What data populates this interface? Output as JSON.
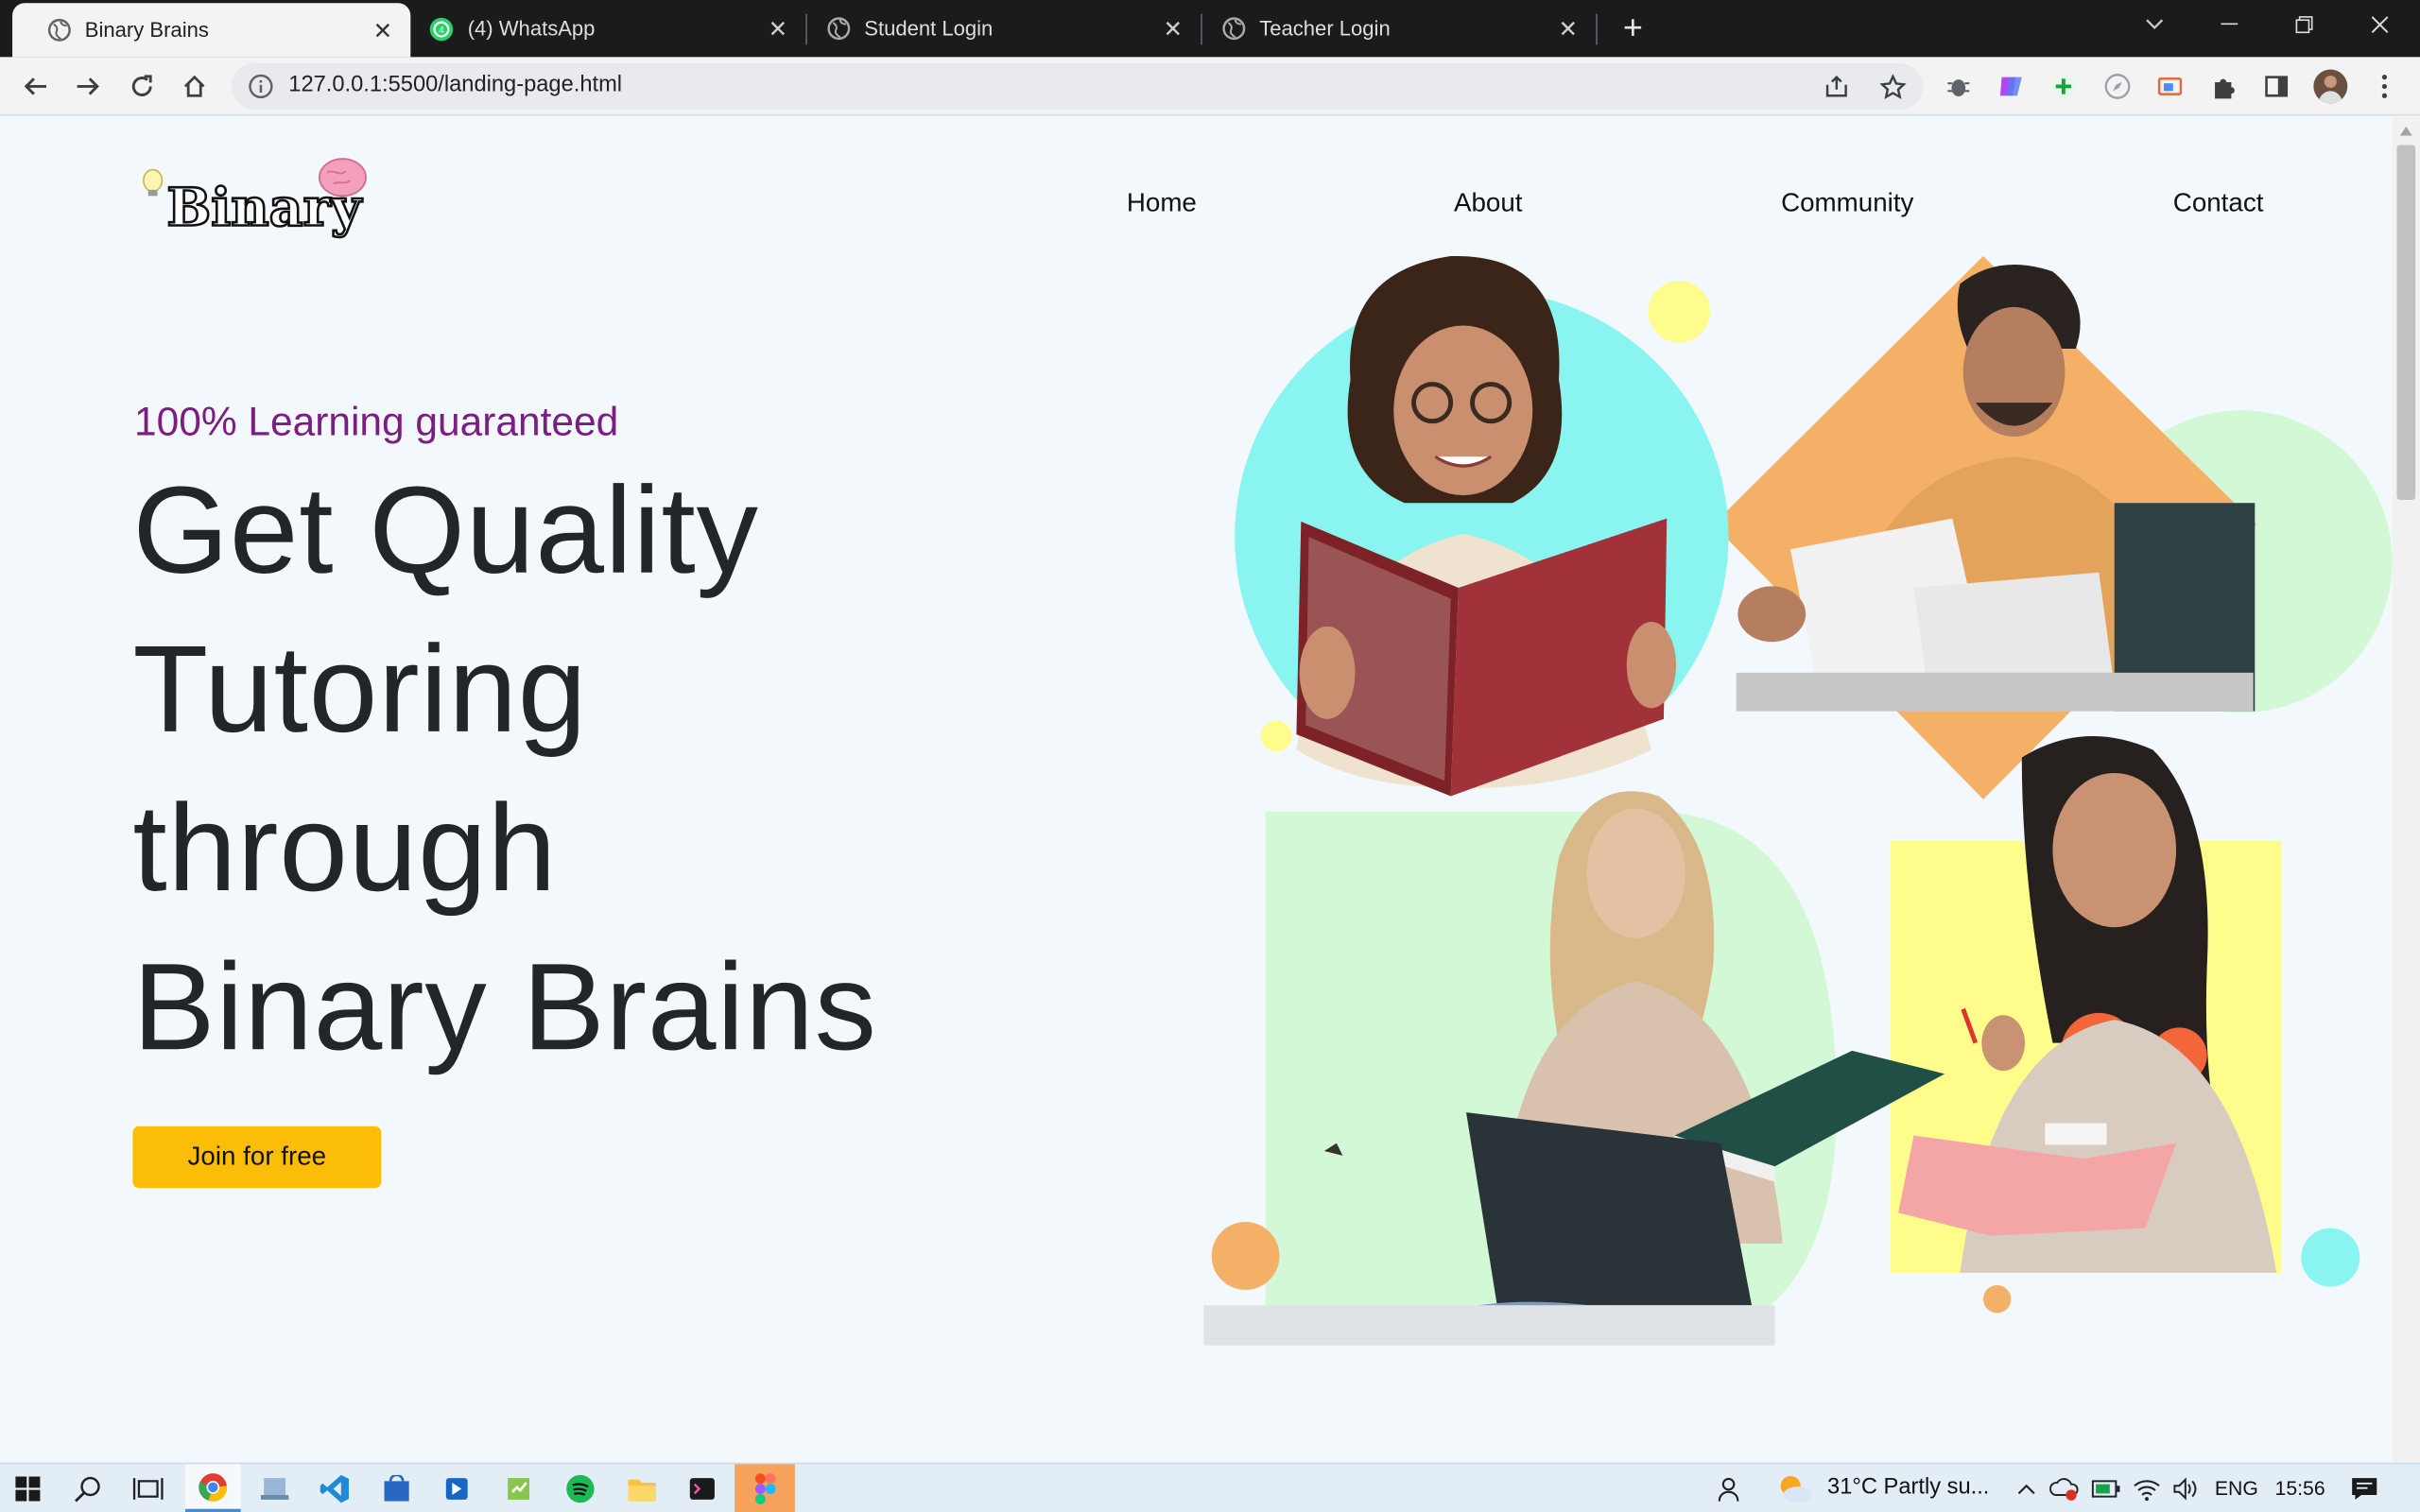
{
  "browser": {
    "tabs": [
      {
        "title": "Binary Brains",
        "active": true
      },
      {
        "title": "(4) WhatsApp",
        "active": false
      },
      {
        "title": "Student Login",
        "active": false
      },
      {
        "title": "Teacher Login",
        "active": false
      }
    ],
    "url": "127.0.0.1:5500/landing-page.html",
    "icons": {
      "back": "arrow-left-icon",
      "forward": "arrow-right-icon",
      "reload": "reload-icon",
      "home": "home-icon",
      "info": "info-icon",
      "share": "share-icon",
      "bookmark": "star-icon",
      "extensions": "puzzle-icon",
      "sidepanel": "side-panel-icon",
      "profile": "avatar",
      "menu": "kebab-menu-icon"
    }
  },
  "page": {
    "logo_text": "Binary",
    "nav": [
      {
        "label": "Home"
      },
      {
        "label": "About"
      },
      {
        "label": "Community"
      },
      {
        "label": "Contact"
      }
    ],
    "tagline": "100% Learning guaranteed",
    "headline": [
      "Get Quality",
      "Tutoring",
      "through",
      "Binary Brains"
    ],
    "cta": "Join for free",
    "colors": {
      "background": "#f3f8fc",
      "tagline": "#7b1d83",
      "cta": "#fbbd08",
      "cyan": "#8af5f0",
      "orange": "#f4b066",
      "green": "#d3f8d6",
      "yellow": "#fefc8a"
    }
  },
  "taskbar": {
    "weather": "31°C  Partly su...",
    "language": "ENG",
    "time": "15:56",
    "apps": [
      "windows-start-icon",
      "search-icon",
      "task-view-icon",
      "chrome-icon",
      "virtualbox-icon",
      "vscode-icon",
      "store-icon",
      "app-icon",
      "notepad-icon",
      "spotify-icon",
      "file-explorer-icon",
      "terminal-icon",
      "figma-icon"
    ]
  }
}
